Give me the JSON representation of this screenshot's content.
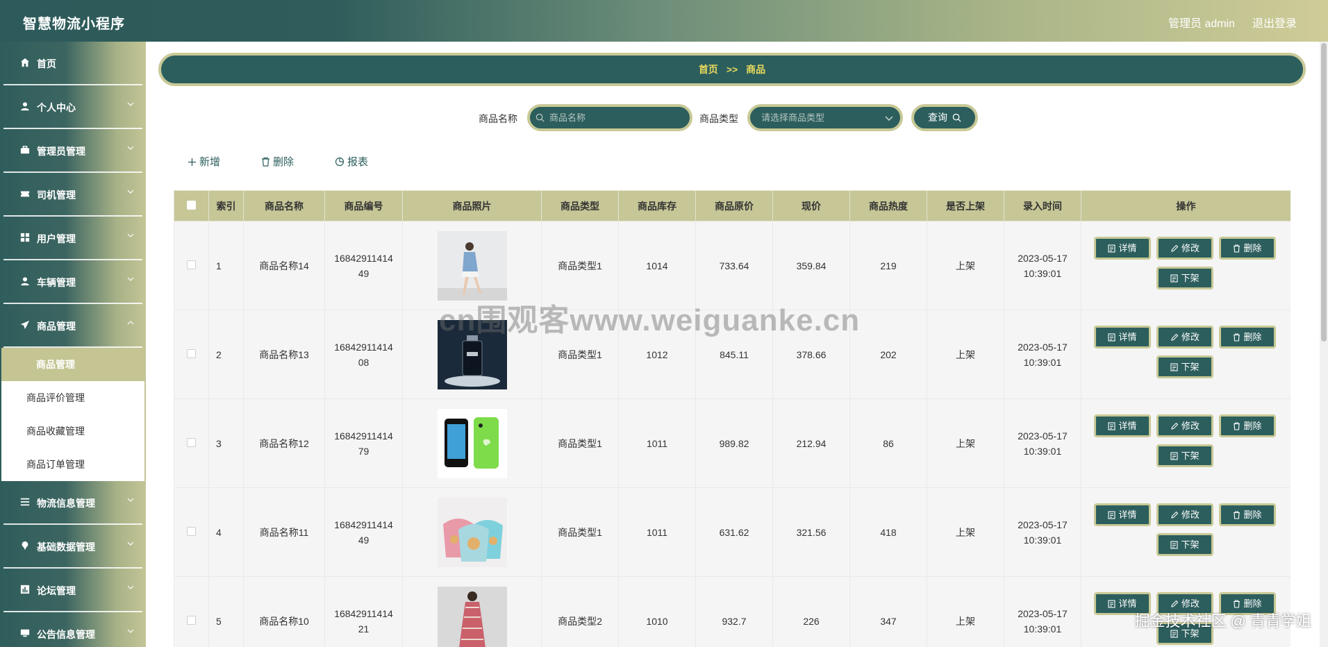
{
  "header": {
    "title": "智慧物流小程序",
    "admin": "管理员 admin",
    "logout": "退出登录"
  },
  "sidebar": {
    "items": [
      {
        "label": "首页",
        "icon": "home-icon"
      },
      {
        "label": "个人中心",
        "icon": "user-icon"
      },
      {
        "label": "管理员管理",
        "icon": "briefcase-icon"
      },
      {
        "label": "司机管理",
        "icon": "ticket-icon"
      },
      {
        "label": "用户管理",
        "icon": "grid-icon"
      },
      {
        "label": "车辆管理",
        "icon": "user-icon"
      },
      {
        "label": "商品管理",
        "icon": "send-icon"
      }
    ],
    "submenu": [
      {
        "label": "商品管理",
        "active": true
      },
      {
        "label": "商品评价管理"
      },
      {
        "label": "商品收藏管理"
      },
      {
        "label": "商品订单管理"
      }
    ],
    "items_after": [
      {
        "label": "物流信息管理",
        "icon": "list-icon"
      },
      {
        "label": "基础数据管理",
        "icon": "pin-icon"
      },
      {
        "label": "论坛管理",
        "icon": "chart-icon"
      },
      {
        "label": "公告信息管理",
        "icon": "monitor-icon"
      }
    ]
  },
  "breadcrumb": {
    "home": "首页",
    "sep": ">>",
    "current": "商品"
  },
  "search": {
    "name_label": "商品名称",
    "name_placeholder": "商品名称",
    "type_label": "商品类型",
    "type_placeholder": "请选择商品类型",
    "query_button": "查询"
  },
  "toolbar": {
    "add": "新增",
    "delete": "删除",
    "report": "报表"
  },
  "table": {
    "headers": [
      "索引",
      "商品名称",
      "商品编号",
      "商品照片",
      "商品类型",
      "商品库存",
      "商品原价",
      "现价",
      "商品热度",
      "是否上架",
      "录入时间",
      "操作"
    ],
    "rows": [
      {
        "index": "1",
        "name": "商品名称14",
        "code": "1684291141449",
        "photo": "person-photo",
        "type": "商品类型1",
        "stock": "1014",
        "original_price": "733.64",
        "price": "359.84",
        "heat": "219",
        "on_sale": "上架",
        "time": "2023-05-17 10:39:01"
      },
      {
        "index": "2",
        "name": "商品名称13",
        "code": "1684291141408",
        "photo": "bottle-photo",
        "type": "商品类型1",
        "stock": "1012",
        "original_price": "845.11",
        "price": "378.66",
        "heat": "202",
        "on_sale": "上架",
        "time": "2023-05-17 10:39:01"
      },
      {
        "index": "3",
        "name": "商品名称12",
        "code": "1684291141479",
        "photo": "phone-photo",
        "type": "商品类型1",
        "stock": "1011",
        "original_price": "989.82",
        "price": "212.94",
        "heat": "86",
        "on_sale": "上架",
        "time": "2023-05-17 10:39:01"
      },
      {
        "index": "4",
        "name": "商品名称11",
        "code": "1684291141449",
        "photo": "cups-photo",
        "type": "商品类型1",
        "stock": "1011",
        "original_price": "631.62",
        "price": "321.56",
        "heat": "418",
        "on_sale": "上架",
        "time": "2023-05-17 10:39:01"
      },
      {
        "index": "5",
        "name": "商品名称10",
        "code": "1684291141421",
        "photo": "dress-photo",
        "type": "商品类型2",
        "stock": "1010",
        "original_price": "932.7",
        "price": "226",
        "heat": "347",
        "on_sale": "上架",
        "time": "2023-05-17 10:39:01"
      }
    ],
    "ops": {
      "detail": "详情",
      "edit": "修改",
      "delete": "删除",
      "off": "下架"
    }
  },
  "watermark": "cn围观客www.weiguanke.cn",
  "credit": "掘金技术社区 @ 青青学姐",
  "colors": {
    "primary": "#2c5e5d",
    "accent": "#c8c996",
    "breadcrumb_text": "#e8d95d"
  }
}
